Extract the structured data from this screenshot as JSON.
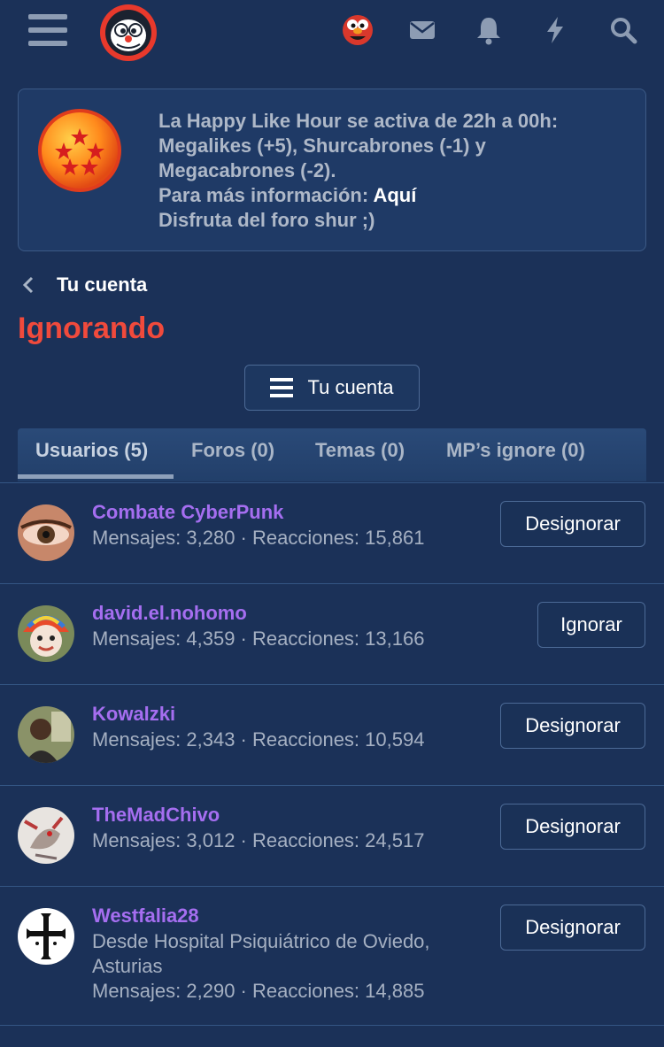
{
  "header": {
    "icons": [
      "menu-icon",
      "site-logo",
      "user-avatar",
      "envelope-icon",
      "bell-icon",
      "bolt-icon",
      "search-icon"
    ]
  },
  "notice": {
    "line1": "La Happy Like Hour se activa de 22h a 00h:",
    "line2": "Megalikes (+5), Shurcabrones (-1) y",
    "line3": "Megacabrones (-2).",
    "line4_prefix": "Para más información: ",
    "line4_link": "Aquí",
    "line5": "Disfruta del foro shur ;)"
  },
  "breadcrumb": {
    "label": "Tu cuenta"
  },
  "page_title": "Ignorando",
  "account_button": {
    "label": "Tu cuenta"
  },
  "tabs": [
    {
      "label": "Usuarios (5)",
      "active": true
    },
    {
      "label": "Foros (0)",
      "active": false
    },
    {
      "label": "Temas (0)",
      "active": false
    },
    {
      "label": "MP’s ignore (0)",
      "active": false
    }
  ],
  "users": [
    {
      "name": "Combate CyberPunk",
      "meta": "Mensajes: 3,280 · Reacciones: 15,861",
      "location": "",
      "button": "Designorar"
    },
    {
      "name": "david.el.nohomo",
      "meta": "Mensajes: 4,359 · Reacciones: 13,166",
      "location": "",
      "button": "Ignorar"
    },
    {
      "name": "Kowalzki",
      "meta": "Mensajes: 2,343 · Reacciones: 10,594",
      "location": "",
      "button": "Designorar"
    },
    {
      "name": "TheMadChivo",
      "meta": "Mensajes: 3,012 · Reacciones: 24,517",
      "location": "",
      "button": "Designorar"
    },
    {
      "name": "Westfalia28",
      "meta": "Mensajes: 2,290 · Reacciones: 14,885",
      "location_line1": "Desde Hospital Psiquiátrico de Oviedo,",
      "location_line2": "Asturias",
      "button": "Designorar"
    }
  ],
  "colors": {
    "background": "#1b3158",
    "title": "#f04a3c",
    "username": "#a56ef0",
    "meta": "#a5b0c2"
  }
}
